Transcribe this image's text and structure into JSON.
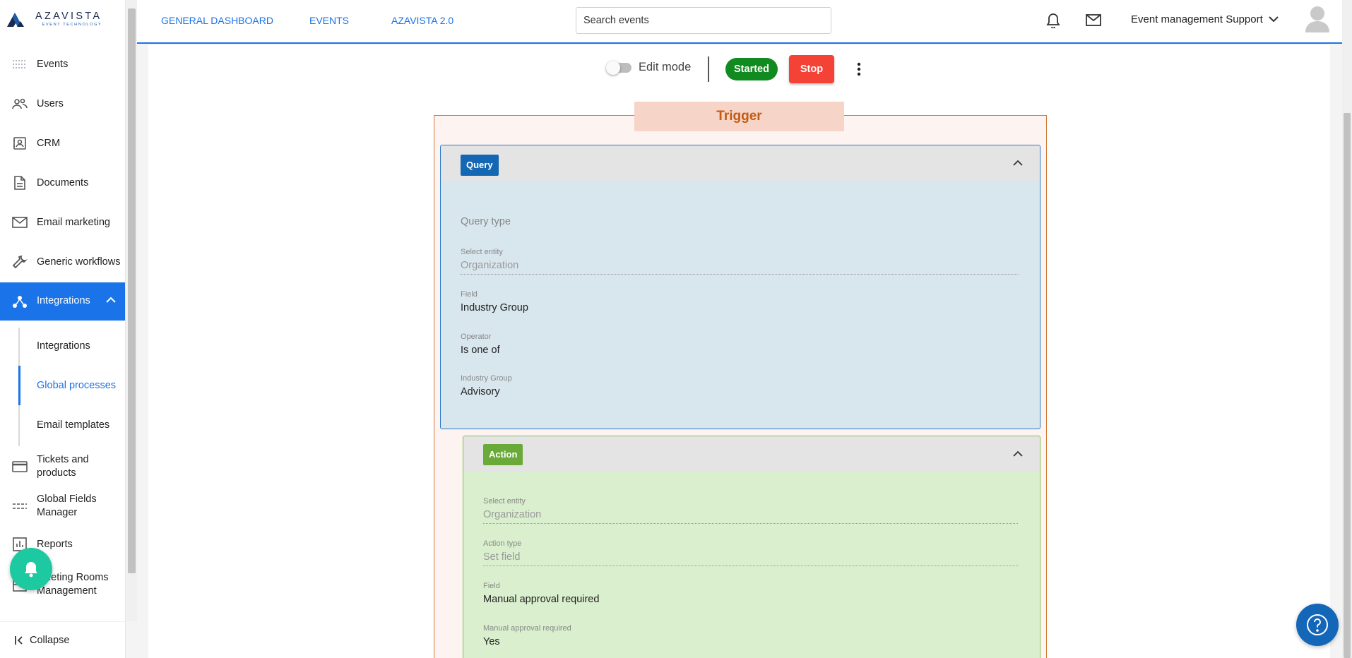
{
  "brand": {
    "name": "AZAVISTA",
    "tagline": "EVENT TECHNOLOGY"
  },
  "sidebar": {
    "items": [
      {
        "label": "Events",
        "icon": "events-icon"
      },
      {
        "label": "Users",
        "icon": "users-icon"
      },
      {
        "label": "CRM",
        "icon": "crm-icon"
      },
      {
        "label": "Documents",
        "icon": "document-icon"
      },
      {
        "label": "Email marketing",
        "icon": "mail-icon"
      },
      {
        "label": "Generic workflows",
        "icon": "wrench-icon"
      },
      {
        "label": "Integrations",
        "icon": "integrations-icon",
        "expanded": true
      },
      {
        "label": "Tickets and products",
        "icon": "card-icon"
      },
      {
        "label": "Global Fields Manager",
        "icon": "fields-icon"
      },
      {
        "label": "Reports",
        "icon": "reports-icon"
      },
      {
        "label": "Meeting Rooms Management",
        "icon": "rooms-icon"
      }
    ],
    "sub_items": [
      {
        "label": "Integrations"
      },
      {
        "label": "Global processes",
        "selected": true
      },
      {
        "label": "Email templates"
      }
    ],
    "collapse_label": "Collapse"
  },
  "topbar": {
    "links": [
      "GENERAL DASHBOARD",
      "EVENTS",
      "AZAVISTA 2.0"
    ],
    "search_placeholder": "Search events",
    "user_name": "Event management Support"
  },
  "toolbar": {
    "edit_mode_label": "Edit mode",
    "edit_mode_on": false,
    "status_label": "Started",
    "stop_label": "Stop"
  },
  "trigger": {
    "title": "Trigger",
    "query": {
      "tag": "Query",
      "query_type_label": "Query type",
      "fields": [
        {
          "label": "Select entity",
          "value": "Organization",
          "muted": true
        },
        {
          "label": "Field",
          "value": "Industry Group"
        },
        {
          "label": "Operator",
          "value": "Is one of"
        },
        {
          "label": "Industry Group",
          "value": "Advisory"
        }
      ]
    },
    "action": {
      "tag": "Action",
      "fields": [
        {
          "label": "Select entity",
          "value": "Organization",
          "muted": true
        },
        {
          "label": "Action type",
          "value": "Set field",
          "muted": true
        },
        {
          "label": "Field",
          "value": "Manual approval required"
        },
        {
          "label": "Manual approval required",
          "value": "Yes"
        }
      ]
    }
  },
  "colors": {
    "primary": "#1a73e8",
    "started": "#118a1f",
    "stop": "#f44336",
    "query_tag": "#1467b3",
    "action_tag": "#6aaa38",
    "trigger_title": "#c25c12",
    "fab_notify": "#1dc9a0",
    "fab_help": "#1466b8"
  }
}
